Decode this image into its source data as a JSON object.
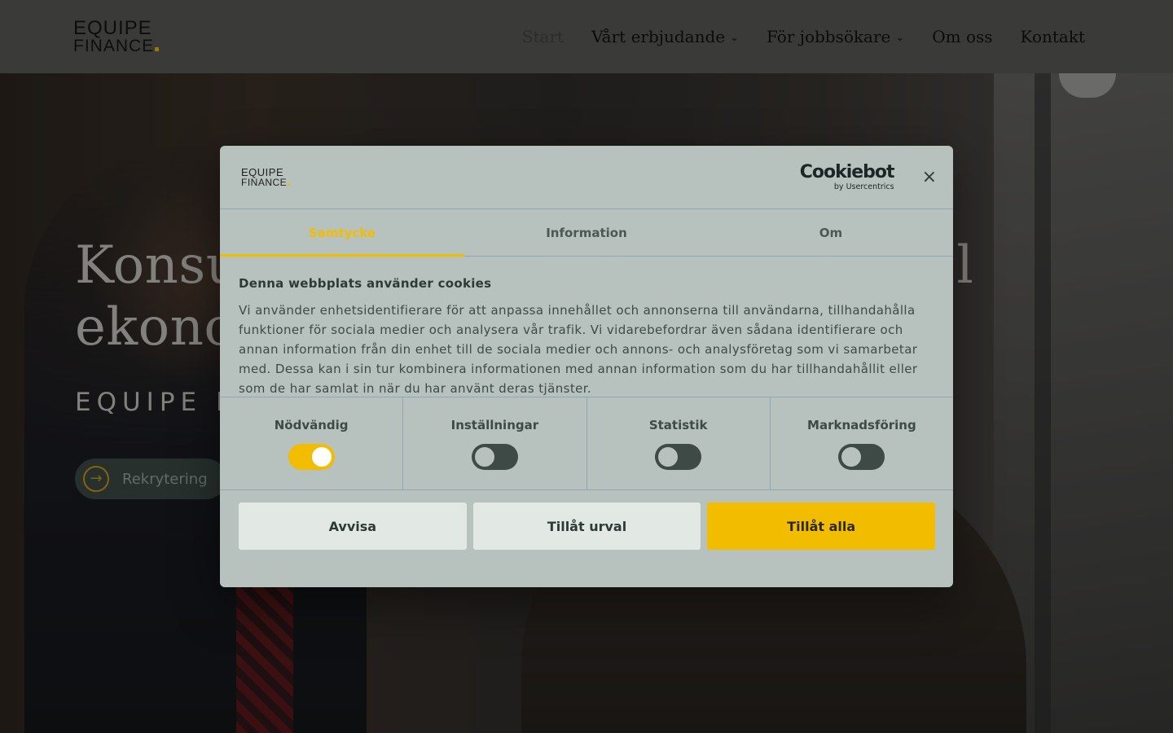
{
  "header": {
    "logo_line1": "EQUIPE",
    "logo_line2": "FINANCE",
    "nav": [
      {
        "label": "Start",
        "active": true,
        "dropdown": false
      },
      {
        "label": "Vårt erbjudande",
        "active": false,
        "dropdown": true
      },
      {
        "label": "För jobbsökare",
        "active": false,
        "dropdown": true
      },
      {
        "label": "Om oss",
        "active": false,
        "dropdown": false
      },
      {
        "label": "Kontakt",
        "active": false,
        "dropdown": false
      }
    ]
  },
  "hero": {
    "title_line1": "Konsu",
    "title_line1_end": "l",
    "title_line2": "ekono",
    "subtitle": "EQUIPE F",
    "cta_label": "Rekrytering"
  },
  "dialog": {
    "logo_line1": "EQUIPE",
    "logo_line2": "FINANCE",
    "brand_main": "Cookiebot",
    "brand_sub": "by Usercentrics",
    "close_icon": "×",
    "tabs": [
      {
        "label": "Samtycke",
        "active": true
      },
      {
        "label": "Information",
        "active": false
      },
      {
        "label": "Om",
        "active": false
      }
    ],
    "heading": "Denna webbplats använder cookies",
    "text": "Vi använder enhetsidentifierare för att anpassa innehållet och annonserna till användarna, tillhandahålla funktioner för sociala medier och analysera vår trafik. Vi vidarebefordrar även sådana identifierare och annan information från din enhet till de sociala medier och annons- och analysföretag som vi samarbetar med. Dessa kan i sin tur kombinera informationen med annan information som du har tillhandahållit eller som de har samlat in när du har använt deras tjänster.",
    "categories": [
      {
        "label": "Nödvändig",
        "on": true
      },
      {
        "label": "Inställningar",
        "on": false
      },
      {
        "label": "Statistik",
        "on": false
      },
      {
        "label": "Marknadsföring",
        "on": false
      }
    ],
    "buttons": {
      "reject": "Avvisa",
      "allow_selection": "Tillåt urval",
      "allow_all": "Tillåt alla"
    }
  },
  "colors": {
    "accent": "#f2bd00",
    "dialog_bg": "#b7c1be",
    "dark_toggle": "#3d4a45"
  }
}
